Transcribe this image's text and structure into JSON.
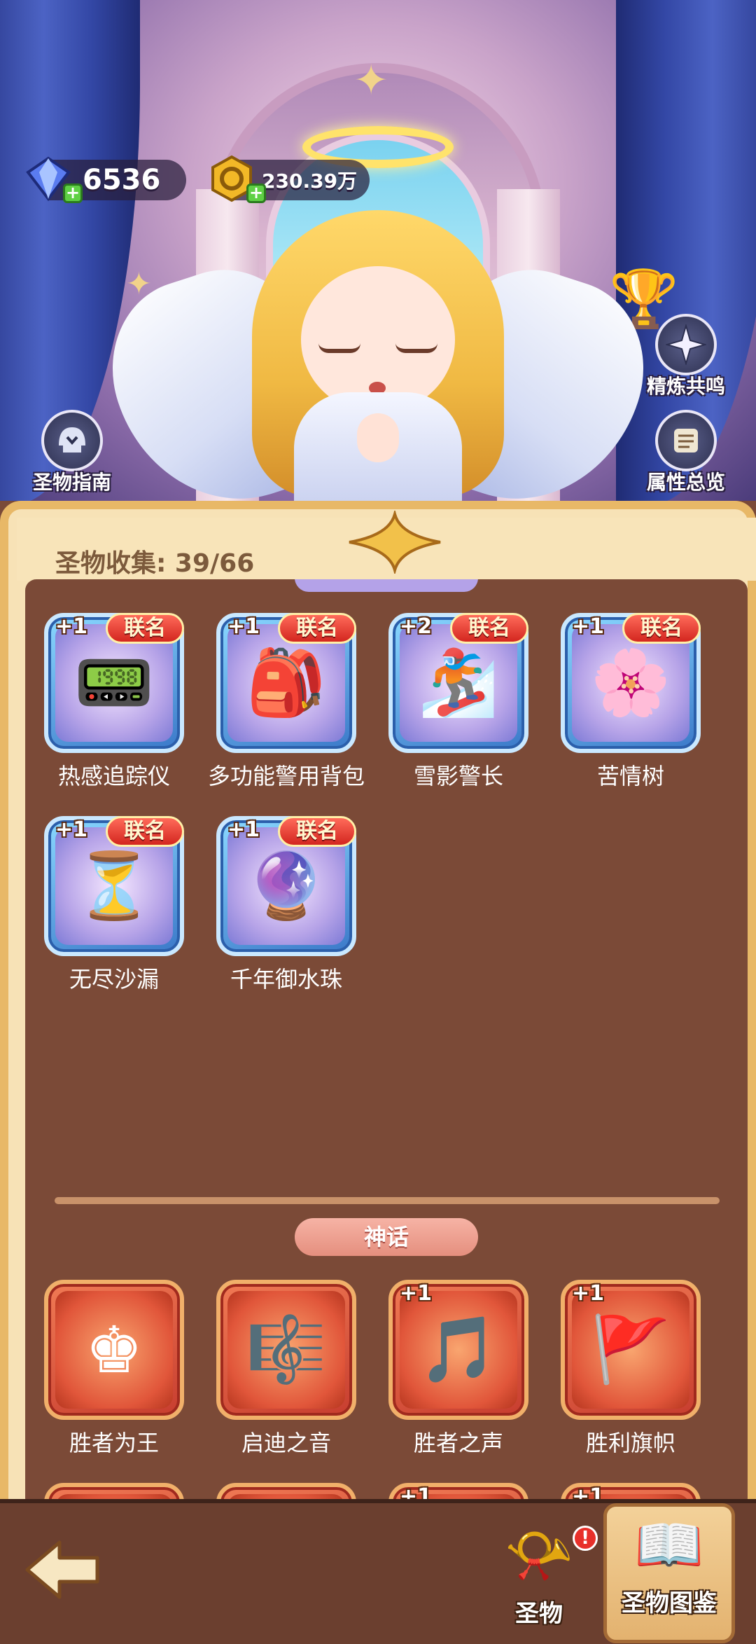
{
  "currency": {
    "gems": "6536",
    "gold": "230.39万"
  },
  "side_buttons": {
    "guide": "圣物指南",
    "refine": "精炼共鸣",
    "attributes": "属性总览"
  },
  "panel": {
    "collection_label": "圣物收集: 39/66"
  },
  "sections": {
    "myth": "神话"
  },
  "collab_items": [
    {
      "name": "热感追踪仪",
      "level": "+1",
      "tag": "联名",
      "icon": "radio-device-icon",
      "glyph": "📟"
    },
    {
      "name": "多功能警用背包",
      "level": "+1",
      "tag": "联名",
      "icon": "backpack-icon",
      "glyph": "🎒"
    },
    {
      "name": "雪影警长",
      "level": "+2",
      "tag": "联名",
      "icon": "snowboard-cat-icon",
      "glyph": "🏂"
    },
    {
      "name": "苦情树",
      "level": "+1",
      "tag": "联名",
      "icon": "pink-tree-icon",
      "glyph": "🌸"
    },
    {
      "name": "无尽沙漏",
      "level": "+1",
      "tag": "联名",
      "icon": "hourglass-icon",
      "glyph": "⏳"
    },
    {
      "name": "千年御水珠",
      "level": "+1",
      "tag": "联名",
      "icon": "water-orb-icon",
      "glyph": "🔮"
    }
  ],
  "myth_items": [
    {
      "name": "胜者为王",
      "level": "",
      "icon": "chess-king-icon",
      "glyph": "♚"
    },
    {
      "name": "启迪之音",
      "level": "",
      "icon": "harp-icon",
      "glyph": "🎼"
    },
    {
      "name": "胜者之声",
      "level": "+1",
      "icon": "flute-icon",
      "glyph": "🎵"
    },
    {
      "name": "胜利旗帜",
      "level": "+1",
      "icon": "banner-icon",
      "glyph": "🚩"
    },
    {
      "name": "",
      "level": "",
      "icon": "crystal-globe-icon",
      "glyph": "🌐"
    },
    {
      "name": "",
      "level": "",
      "icon": "dice-icon",
      "glyph": "🎲"
    },
    {
      "name": "",
      "level": "+1",
      "icon": "winged-cloak-icon",
      "glyph": "🦇"
    },
    {
      "name": "",
      "level": "+1",
      "icon": "potion-icon",
      "glyph": "🧪"
    }
  ],
  "bottom_nav": {
    "relic": "圣物",
    "codex": "圣物图鉴",
    "badge": "!"
  }
}
